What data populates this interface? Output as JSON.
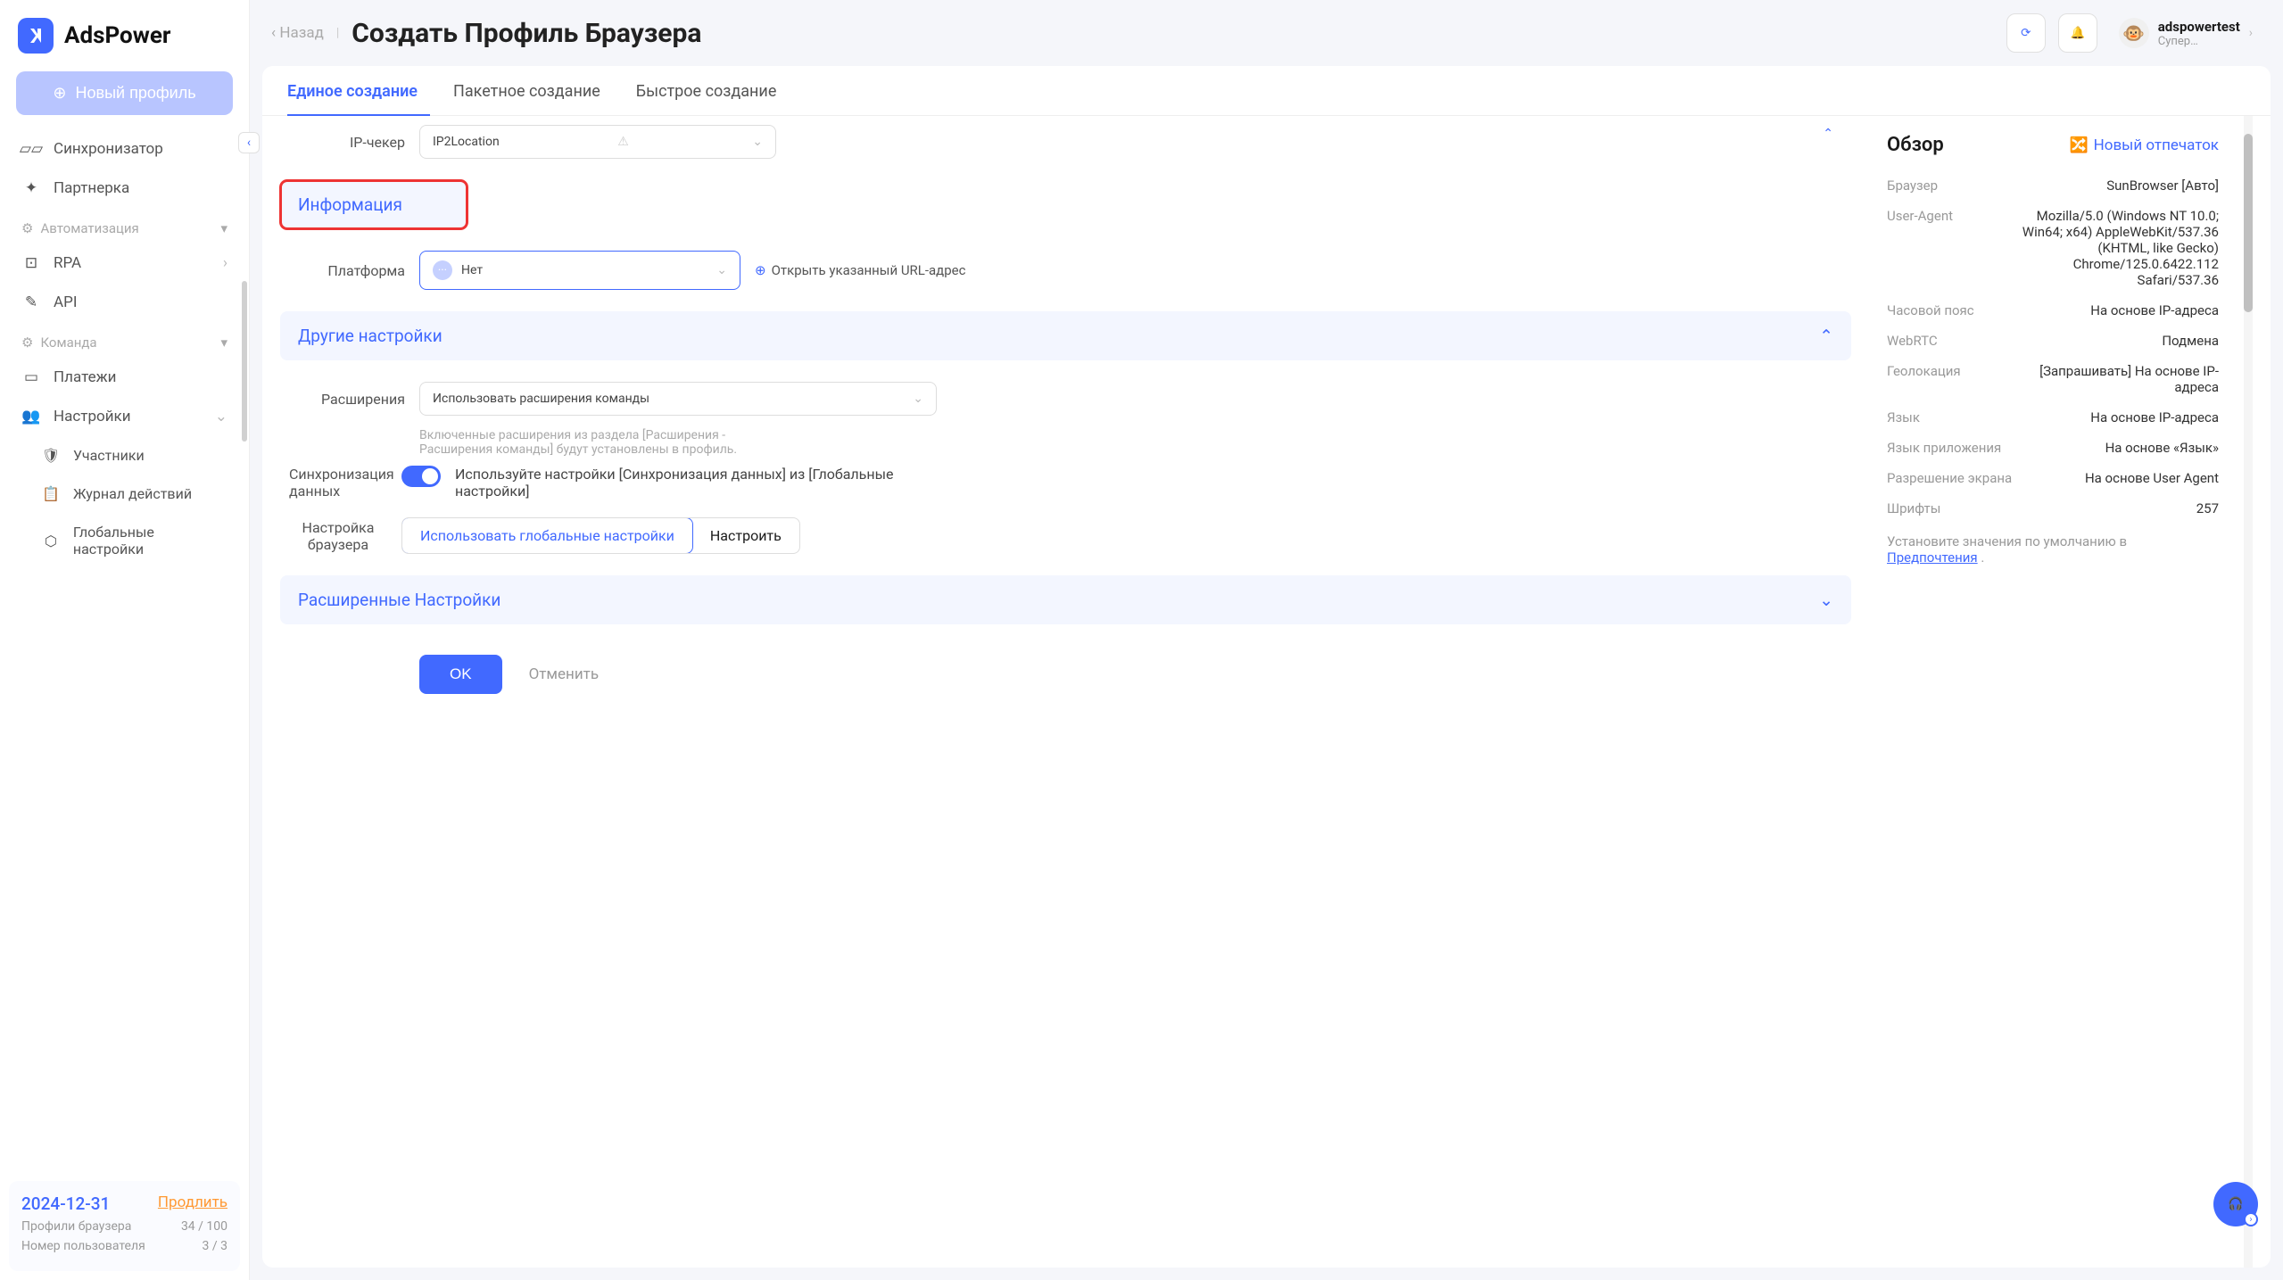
{
  "brand": "AdsPower",
  "sidebar": {
    "new_profile": "Новый профиль",
    "items_top": [
      {
        "label": "Синхронизатор"
      },
      {
        "label": "Партнерка"
      }
    ],
    "section_automation": "Автоматизация",
    "items_automation": [
      {
        "label": "RPA"
      },
      {
        "label": "API"
      }
    ],
    "section_team": "Команда",
    "items_team": [
      {
        "label": "Платежи"
      },
      {
        "label": "Настройки"
      }
    ],
    "items_settings_sub": [
      {
        "label": "Участники"
      },
      {
        "label": "Журнал действий"
      },
      {
        "label": "Глобальные настройки"
      }
    ],
    "footer": {
      "date": "2024-12-31",
      "renew": "Продлить",
      "profiles_label": "Профили браузера",
      "profiles_value": "34 / 100",
      "users_label": "Номер пользователя",
      "users_value": "3 / 3"
    }
  },
  "header": {
    "back": "Назад",
    "title": "Создать Профиль Браузера",
    "user": {
      "name": "adspowertest",
      "role": "Супер…"
    }
  },
  "tabs": [
    {
      "label": "Единое создание",
      "active": true
    },
    {
      "label": "Пакетное создание"
    },
    {
      "label": "Быстрое создание"
    }
  ],
  "form": {
    "ip_checker_label": "IP-чекер",
    "ip_checker_value": "IP2Location",
    "section_info": "Информация",
    "platform_label": "Платформа",
    "platform_value": "Нет",
    "open_url": "Открыть указанный URL-адрес",
    "section_other": "Другие настройки",
    "extensions_label": "Расширения",
    "extensions_value": "Использовать расширения команды",
    "extensions_help": "Включенные расширения из раздела [Расширения - Расширения команды] будут установлены в профиль.",
    "sync_label": "Синхронизация данных",
    "sync_text": "Используйте настройки [Синхронизация данных] из [Глобальные настройки]",
    "browser_settings_label": "Настройка браузера",
    "browser_settings_global": "Использовать глобальные настройки",
    "browser_settings_custom": "Настроить",
    "section_advanced": "Расширенные Настройки",
    "ok": "OK",
    "cancel": "Отменить"
  },
  "summary": {
    "title": "Обзор",
    "new_fingerprint": "Новый отпечаток",
    "rows": [
      {
        "k": "Браузер",
        "v": "SunBrowser [Авто]"
      },
      {
        "k": "User-Agent",
        "v": "Mozilla/5.0 (Windows NT 10.0; Win64; x64) AppleWebKit/537.36 (KHTML, like Gecko) Chrome/125.0.6422.112 Safari/537.36"
      },
      {
        "k": "Часовой пояс",
        "v": "На основе IP-адреса"
      },
      {
        "k": "WebRTC",
        "v": "Подмена"
      },
      {
        "k": "Геолокация",
        "v": "[Запрашивать] На основе IP-адреса"
      },
      {
        "k": "Язык",
        "v": "На основе IP-адреса"
      },
      {
        "k": "Язык приложения",
        "v": "На основе «Язык»"
      },
      {
        "k": "Разрешение экрана",
        "v": "На основе User Agent"
      },
      {
        "k": "Шрифты",
        "v": "257"
      }
    ],
    "note_prefix": "Установите значения по умолчанию в ",
    "note_link": "Предпочтения",
    "note_suffix": " ."
  }
}
